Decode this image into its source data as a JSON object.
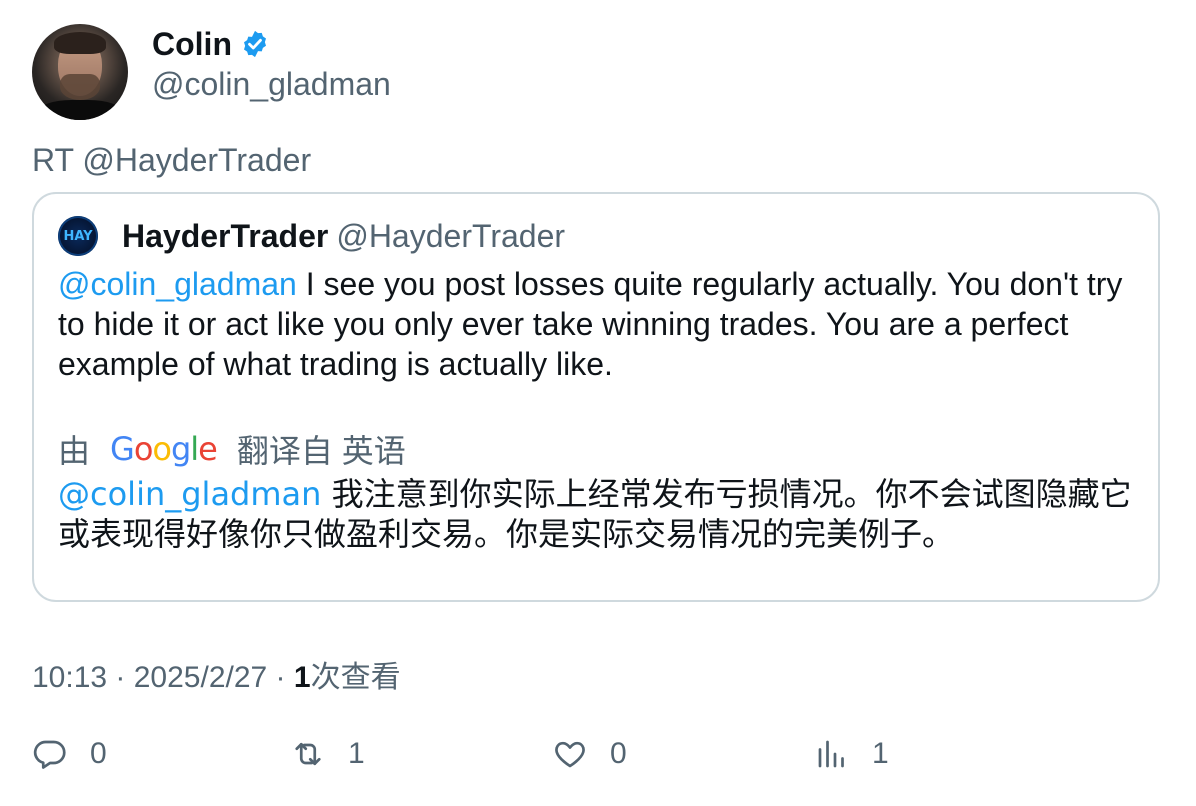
{
  "author": {
    "display_name": "Colin",
    "handle": "@colin_gladman"
  },
  "retweet_line": "RT @HayderTrader",
  "quoted_tweet": {
    "display_name": "HayderTrader",
    "handle": "@HayderTrader",
    "avatar_text": "HAY",
    "mention": "@colin_gladman",
    "body": " I see you post losses quite regularly actually. You don't try to hide it or act like you only ever take winning trades. You are a perfect example of what trading is actually like.",
    "translation": {
      "prefix": "由",
      "provider": "Google",
      "suffix": "翻译自 英语",
      "mention": "@colin_gladman",
      "body": " 我注意到你实际上经常发布亏损情况。你不会试图隐藏它或表现得好像你只做盈利交易。你是实际交易情况的完美例子。"
    }
  },
  "meta": {
    "time": "10:13",
    "separator": " · ",
    "date": "2025/2/27",
    "views_count": "1",
    "views_label": "次查看"
  },
  "actions": {
    "replies": "0",
    "retweets": "1",
    "likes": "0",
    "views": "1"
  },
  "colors": {
    "accent": "#1d9bf0",
    "secondary_text": "#536471",
    "border": "#cfd9de"
  }
}
